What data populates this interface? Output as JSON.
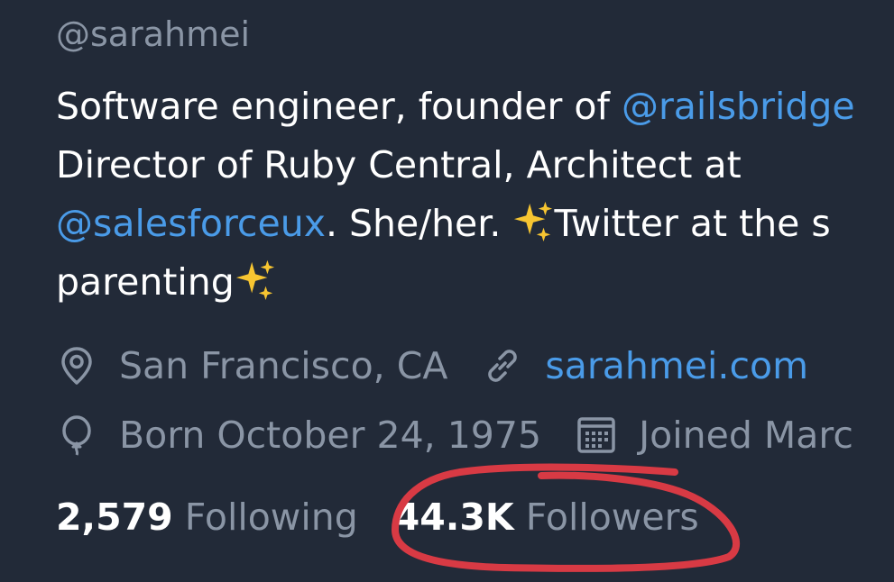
{
  "profile": {
    "handle": "@sarahmei",
    "bio": {
      "line1_text": "Software engineer, founder of ",
      "line1_mention": "@railsbridge",
      "line2_text": "Director of Ruby Central, Architect at",
      "line3_mention": "@salesforceux",
      "line3_text": ". She/her. ",
      "line3_text2": "Twitter at the s",
      "line4_text": "parenting"
    },
    "location": "San Francisco, CA",
    "website": "sarahmei.com",
    "birthday": "Born October 24, 1975",
    "joined": "Joined Marc",
    "following_count": "2,579",
    "following_label": "Following",
    "followers_count": "44.3K",
    "followers_label": "Followers"
  },
  "icons": {
    "location": "location-pin-icon",
    "link": "link-icon",
    "birthday": "balloon-icon",
    "calendar": "calendar-icon",
    "sparkles": "sparkles-emoji"
  },
  "colors": {
    "background": "#222a38",
    "text": "#ffffff",
    "muted": "#8a95a5",
    "accent": "#4a9be8",
    "annotation": "#d83a44"
  }
}
